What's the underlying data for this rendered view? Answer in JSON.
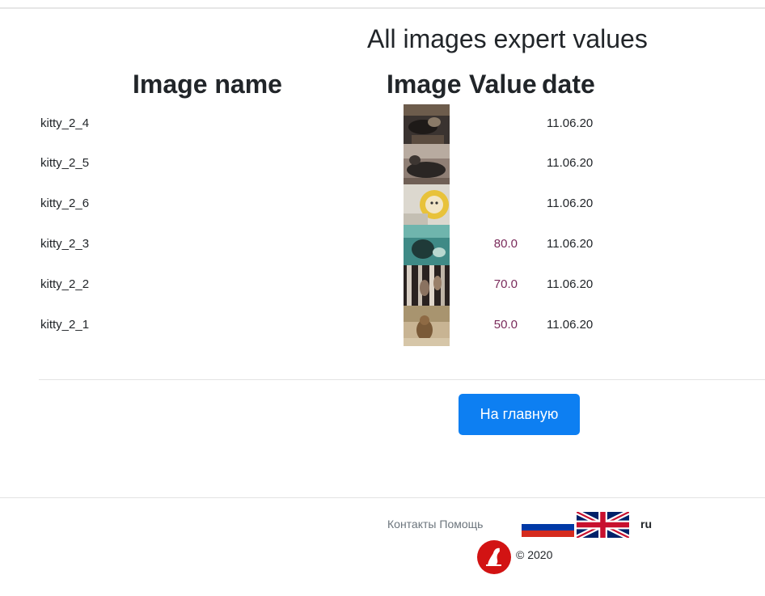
{
  "page": {
    "title": "All images expert values"
  },
  "table": {
    "headers": {
      "name": "Image name",
      "image": "Image",
      "value": "Value",
      "date": "date"
    },
    "rows": [
      {
        "name": "kitty_2_4",
        "value": "",
        "date": "11.06.20",
        "thumb": "dark cat on dark background"
      },
      {
        "name": "kitty_2_5",
        "value": "",
        "date": "11.06.20",
        "thumb": "cat lying on sofa"
      },
      {
        "name": "kitty_2_6",
        "value": "",
        "date": "11.06.20",
        "thumb": "yellow sunflower plush toy"
      },
      {
        "name": "kitty_2_3",
        "value": "80.0",
        "date": "11.06.20",
        "thumb": "teal scene with cat"
      },
      {
        "name": "kitty_2_2",
        "value": "70.0",
        "date": "11.06.20",
        "thumb": "cats hanging on curtain"
      },
      {
        "name": "kitty_2_1",
        "value": "50.0",
        "date": "11.06.20",
        "thumb": "kitten sitting on floor"
      }
    ]
  },
  "actions": {
    "home_label": "На главную",
    "home_color": "#0d7ff2"
  },
  "footer": {
    "contacts": "Контакты",
    "help": "Помощь",
    "language": "ru",
    "copyright": "© 2020"
  },
  "colors": {
    "value_text": "#7a2a5a",
    "logo": "#d21313"
  }
}
